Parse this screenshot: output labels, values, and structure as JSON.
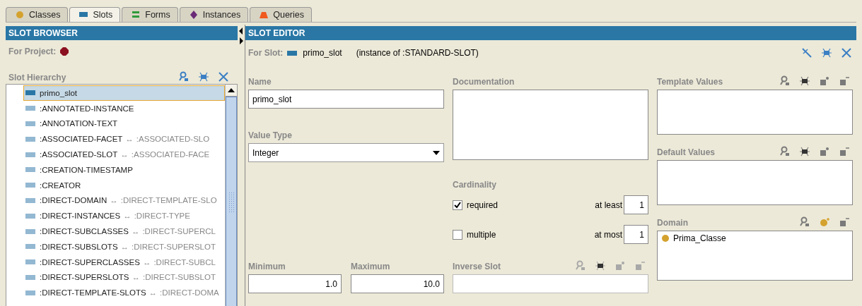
{
  "tabs": [
    {
      "label": "Classes",
      "kind": "class",
      "selected": false
    },
    {
      "label": "Slots",
      "kind": "slot",
      "selected": true
    },
    {
      "label": "Forms",
      "kind": "form",
      "selected": false
    },
    {
      "label": "Instances",
      "kind": "instance",
      "selected": false
    },
    {
      "label": "Queries",
      "kind": "query",
      "selected": false
    }
  ],
  "slot_browser": {
    "title": "SLOT BROWSER",
    "project_label": "For Project:",
    "hierarchy_label": "Slot Hierarchy",
    "items": [
      {
        "name": "primo_slot",
        "selected": true
      },
      {
        "name": ":ANNOTATED-INSTANCE",
        "selected": false
      },
      {
        "name": ":ANNOTATION-TEXT",
        "selected": false
      },
      {
        "name": ":ASSOCIATED-FACET",
        "relation": "↔",
        "inverse": ":ASSOCIATED-SLO",
        "selected": false
      },
      {
        "name": ":ASSOCIATED-SLOT",
        "relation": "↔",
        "inverse": ":ASSOCIATED-FACE",
        "selected": false
      },
      {
        "name": ":CREATION-TIMESTAMP",
        "selected": false
      },
      {
        "name": ":CREATOR",
        "selected": false
      },
      {
        "name": ":DIRECT-DOMAIN",
        "relation": "↔",
        "inverse": ":DIRECT-TEMPLATE-SLO",
        "selected": false
      },
      {
        "name": ":DIRECT-INSTANCES",
        "relation": "↔",
        "inverse": ":DIRECT-TYPE",
        "selected": false
      },
      {
        "name": ":DIRECT-SUBCLASSES",
        "relation": "↔",
        "inverse": ":DIRECT-SUPERCL",
        "selected": false
      },
      {
        "name": ":DIRECT-SUBSLOTS",
        "relation": "↔",
        "inverse": ":DIRECT-SUPERSLOT",
        "selected": false
      },
      {
        "name": ":DIRECT-SUPERCLASSES",
        "relation": "↔",
        "inverse": ":DIRECT-SUBCL",
        "selected": false
      },
      {
        "name": ":DIRECT-SUPERSLOTS",
        "relation": "↔",
        "inverse": ":DIRECT-SUBSLOT",
        "selected": false
      },
      {
        "name": ":DIRECT-TEMPLATE-SLOTS",
        "relation": "↔",
        "inverse": ":DIRECT-DOMA",
        "selected": false
      }
    ]
  },
  "slot_editor": {
    "title": "SLOT EDITOR",
    "for_slot_label": "For Slot:",
    "slot_name": "primo_slot",
    "instance_of": "(instance of :STANDARD-SLOT)",
    "name": {
      "label": "Name",
      "value": "primo_slot"
    },
    "value_type": {
      "label": "Value Type",
      "value": "Integer"
    },
    "documentation": {
      "label": "Documentation"
    },
    "cardinality": {
      "label": "Cardinality",
      "required": {
        "label": "required",
        "checked": true
      },
      "multiple": {
        "label": "multiple",
        "checked": false
      },
      "at_least": {
        "label": "at least",
        "value": "1"
      },
      "at_most": {
        "label": "at most",
        "value": "1"
      }
    },
    "minimum": {
      "label": "Minimum",
      "value": "1.0"
    },
    "maximum": {
      "label": "Maximum",
      "value": "10.0"
    },
    "inverse_slot": {
      "label": "Inverse Slot"
    },
    "template_values": {
      "label": "Template Values"
    },
    "default_values": {
      "label": "Default Values"
    },
    "domain": {
      "label": "Domain",
      "items": [
        {
          "name": "Prima_Classe"
        }
      ]
    }
  }
}
